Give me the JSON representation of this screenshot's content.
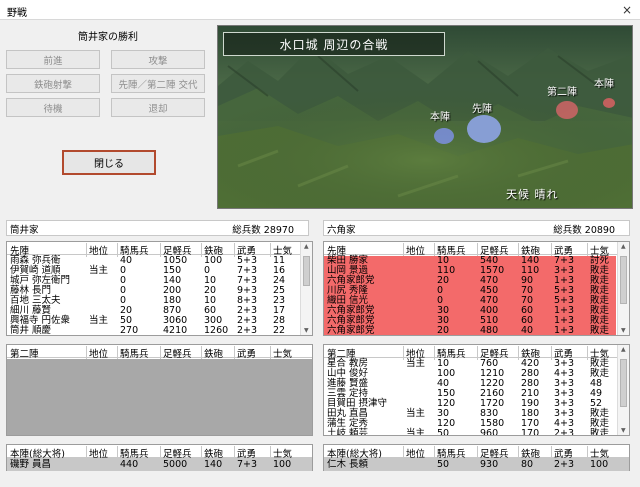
{
  "window": {
    "title": "野戦",
    "close_glyph": "×"
  },
  "command": {
    "result_text": "筒井家の勝利",
    "buttons": [
      "前進",
      "攻撃",
      "鉄砲射撃",
      "先陣／第二陣 交代",
      "待機",
      "退却"
    ],
    "close_button": "閉じる"
  },
  "map": {
    "title": "水口城 周辺の合戦",
    "labels": {
      "left_honjin": "本陣",
      "left_senjin": "先陣",
      "right_daini": "第二陣",
      "right_honjin": "本陣"
    },
    "weather": "天候 晴れ",
    "colors": {
      "blue_army": "#7088d8",
      "red_army": "#c86060"
    }
  },
  "columns": [
    "地位",
    "騎馬兵",
    "足軽兵",
    "鉄砲",
    "武勇",
    "士気"
  ],
  "left": {
    "clan": "筒井家",
    "total": "総兵数 28970",
    "senjin": {
      "header": "先陣",
      "rows": [
        [
          "雨森 弥兵衛",
          "",
          "40",
          "1050",
          "100",
          "5+3",
          "11"
        ],
        [
          "伊賀崎 道順",
          "当主",
          "0",
          "150",
          "0",
          "7+3",
          "16"
        ],
        [
          "城戸 弥左衛門",
          "",
          "0",
          "140",
          "10",
          "7+3",
          "24"
        ],
        [
          "藤林 長門",
          "",
          "0",
          "200",
          "20",
          "9+3",
          "25"
        ],
        [
          "百地 三太夫",
          "",
          "0",
          "180",
          "10",
          "8+3",
          "23"
        ],
        [
          "細川 藤賢",
          "",
          "20",
          "870",
          "60",
          "2+3",
          "17"
        ],
        [
          "興福寺 円佐衆",
          "当主",
          "50",
          "3060",
          "300",
          "2+3",
          "28"
        ],
        [
          "筒井 順慶",
          "",
          "270",
          "4210",
          "1260",
          "2+3",
          "22"
        ]
      ]
    },
    "daini": {
      "header": "第二陣",
      "rows": []
    },
    "honjin": {
      "header": "本陣(総大将)",
      "row": [
        "磯野 員昌",
        "",
        "440",
        "5000",
        "140",
        "7+3",
        "100"
      ]
    }
  },
  "right": {
    "clan": "六角家",
    "total": "総兵数 20890",
    "senjin": {
      "header": "先陣",
      "rows": [
        [
          "柴田 勝家",
          "",
          "10",
          "540",
          "140",
          "7+3",
          "討死"
        ],
        [
          "山岡 景過",
          "",
          "110",
          "1570",
          "110",
          "3+3",
          "敗走"
        ],
        [
          "六角家郎党",
          "",
          "20",
          "470",
          "90",
          "1+3",
          "敗走"
        ],
        [
          "川尻 秀隆",
          "",
          "0",
          "450",
          "70",
          "5+3",
          "敗走"
        ],
        [
          "織田 信光",
          "",
          "0",
          "470",
          "70",
          "5+3",
          "敗走"
        ],
        [
          "六角家郎党",
          "",
          "30",
          "400",
          "60",
          "1+3",
          "敗走"
        ],
        [
          "六角家郎党",
          "",
          "30",
          "510",
          "60",
          "1+3",
          "敗走"
        ],
        [
          "六角家郎党",
          "",
          "20",
          "480",
          "40",
          "1+3",
          "敗走"
        ]
      ]
    },
    "daini": {
      "header": "第二陣",
      "rows": [
        [
          "星合 教房",
          "当主",
          "10",
          "760",
          "420",
          "3+3",
          "敗走"
        ],
        [
          "山中 俊好",
          "",
          "100",
          "1210",
          "280",
          "4+3",
          "敗走"
        ],
        [
          "進藤 賢盛",
          "",
          "40",
          "1220",
          "280",
          "3+3",
          "48"
        ],
        [
          "三雲 定持",
          "",
          "150",
          "2160",
          "210",
          "3+3",
          "49"
        ],
        [
          "目賀田 摂津守",
          "",
          "120",
          "1720",
          "190",
          "3+3",
          "52"
        ],
        [
          "田丸 直昌",
          "当主",
          "30",
          "830",
          "180",
          "3+3",
          "敗走"
        ],
        [
          "蒲生 定秀",
          "",
          "120",
          "1580",
          "170",
          "4+3",
          "敗走"
        ],
        [
          "土岐 頼芸",
          "当主",
          "50",
          "960",
          "170",
          "2+3",
          "敗走"
        ]
      ]
    },
    "honjin": {
      "header": "本陣(総大将)",
      "row": [
        "仁木 長頼",
        "",
        "50",
        "930",
        "80",
        "2+3",
        "100"
      ]
    }
  }
}
